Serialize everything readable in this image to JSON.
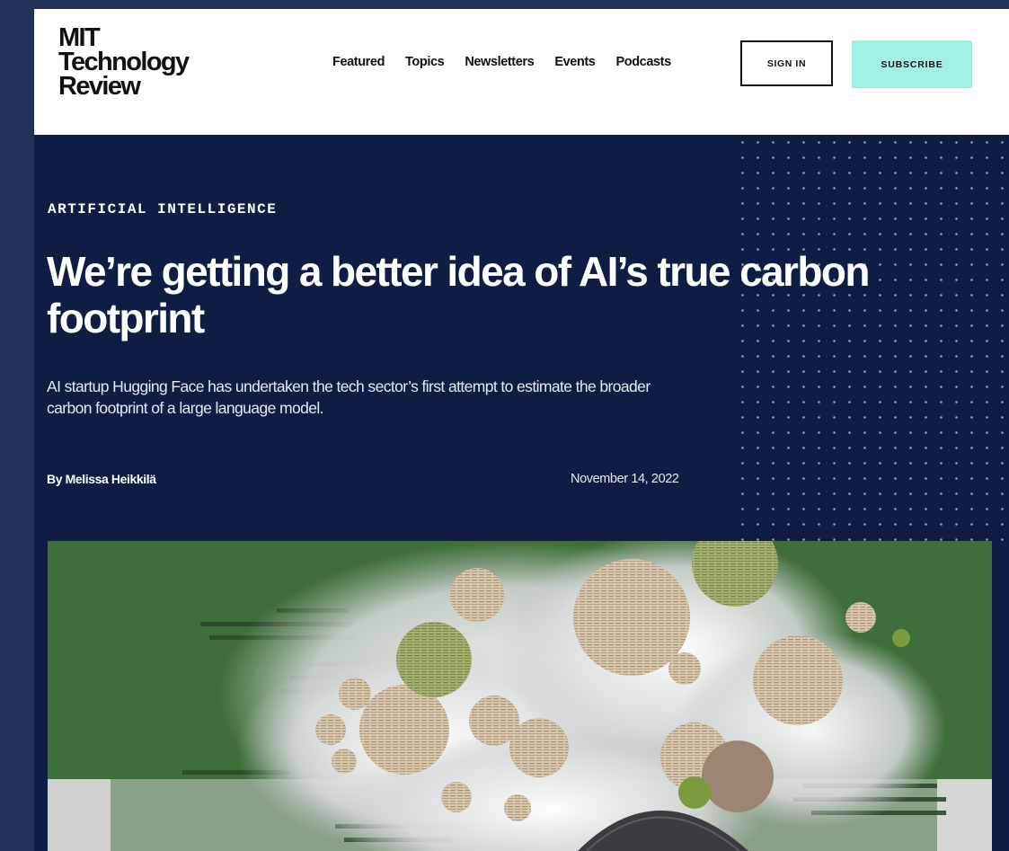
{
  "site": {
    "logo_lines": [
      "MIT",
      "Technology",
      "Review"
    ]
  },
  "nav": {
    "items": [
      "Featured",
      "Topics",
      "Newsletters",
      "Events",
      "Podcasts"
    ]
  },
  "header": {
    "sign_in_label": "SIGN IN",
    "subscribe_label": "SUBSCRIBE"
  },
  "article": {
    "category": "ARTIFICIAL INTELLIGENCE",
    "title": "We’re getting a better idea of AI’s true carbon footprint",
    "dek": "AI startup Hugging Face has undertaken the tech sector’s first attempt to estimate the broader carbon footprint of a large language model.",
    "byline": "By Melissa Heikkilä",
    "date": "November 14, 2022"
  },
  "colors": {
    "hero_background": "#0f1d45",
    "subscribe_accent": "#9ff0e5",
    "image_green": "#3e6e3a"
  }
}
